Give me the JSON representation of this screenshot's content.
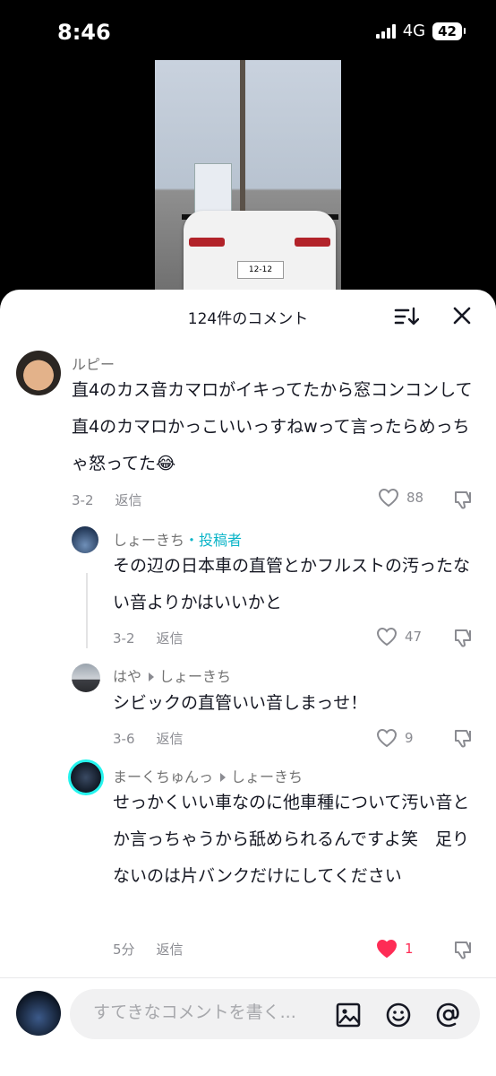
{
  "status_bar": {
    "time": "8:46",
    "network": "4G",
    "battery": "42"
  },
  "video": {
    "plate": "12-12"
  },
  "sheet": {
    "title": "124件のコメント"
  },
  "comments": [
    {
      "name": "ルピー",
      "text": "直4のカス音カマロがイキってたから窓コンコンして直4のカマロかっこいいっすねwって言ったらめっちゃ怒ってた😂",
      "date": "3-2",
      "reply": "返信",
      "likes": "88",
      "liked": false
    },
    {
      "name": "しょーきち",
      "author_tag": "・投稿者",
      "text": "その辺の日本車の直管とかフルストの汚ったない音よりかはいいかと",
      "date": "3-2",
      "reply": "返信",
      "likes": "47",
      "liked": false
    },
    {
      "name": "はや",
      "reply_to": "しょーきち",
      "text": "シビックの直管いい音しまっせ！",
      "date": "3-6",
      "reply": "返信",
      "likes": "9",
      "liked": false
    },
    {
      "name": "まーくちゅんっ",
      "reply_to": "しょーきち",
      "text": "せっかくいい車なのに他車種について汚い音とか言っちゃうから舐められるんですよ笑　足りないのは片バンクだけにしてください",
      "date": "5分",
      "reply": "返信",
      "likes": "1",
      "liked": true
    }
  ],
  "input": {
    "placeholder": "すてきなコメントを書く..."
  },
  "colors": {
    "accent_teal": "#0bb5c8",
    "like_red": "#fe2c55"
  }
}
